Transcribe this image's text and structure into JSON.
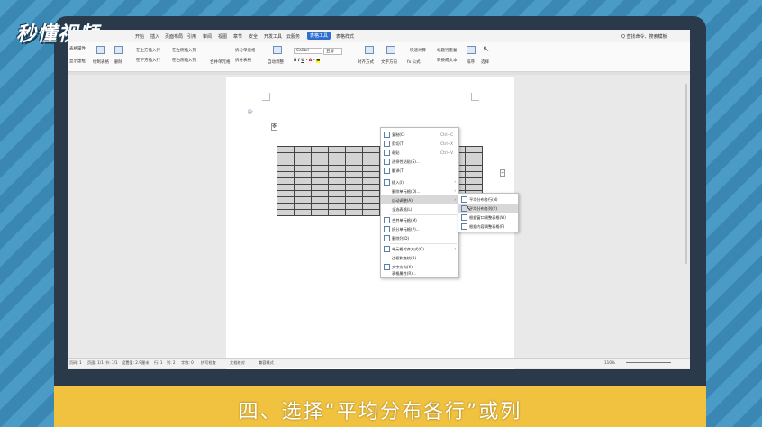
{
  "overlay": {
    "logo": "秒懂视频",
    "caption": "四、选择“平均分布各行”或列"
  },
  "menubar": {
    "items": [
      "开始",
      "插入",
      "页面布局",
      "引用",
      "审阅",
      "视图",
      "章节",
      "安全",
      "开发工具",
      "云服务",
      "表格工具",
      "表格样式"
    ],
    "active": "表格工具",
    "search": "Q 查找命令、搜索模板"
  },
  "ribbon": {
    "labels": [
      "表格属性",
      "显示虚框",
      "绘制表格",
      "删除",
      "在上方插入行",
      "在下方插入行",
      "在左侧插入列",
      "在右侧插入列",
      "合并单元格",
      "拆分单元格",
      "拆分表格",
      "自动调整",
      "Calibri",
      "五号",
      "对齐方式",
      "文字方向",
      "fx 公式",
      "快速计算",
      "标题行重复",
      "转换成文本",
      "排序",
      "选择"
    ]
  },
  "context_menu": {
    "items": [
      {
        "label": "复制(C)",
        "shortcut": "Ctrl+C"
      },
      {
        "label": "剪切(T)",
        "shortcut": "Ctrl+X"
      },
      {
        "label": "粘贴",
        "shortcut": "Ctrl+V"
      },
      {
        "label": "选择性粘贴(S)...",
        "shortcut": ""
      },
      {
        "label": "翻译(T)",
        "shortcut": ""
      },
      {
        "label": "插入(I)",
        "shortcut": ""
      },
      {
        "label": "删除单元格(D)...",
        "shortcut": ""
      },
      {
        "label": "自动调整(A)",
        "shortcut": ""
      },
      {
        "label": "全选表格(L)",
        "shortcut": ""
      },
      {
        "label": "合并单元格(M)",
        "shortcut": ""
      },
      {
        "label": "拆分单元格(P)...",
        "shortcut": ""
      },
      {
        "label": "删除列(D)",
        "shortcut": ""
      },
      {
        "label": "单元格对齐方式(G)",
        "shortcut": ""
      },
      {
        "label": "边框和底纹(B)...",
        "shortcut": ""
      },
      {
        "label": "文字方向(X)...",
        "shortcut": ""
      },
      {
        "label": "表格属性(R)...",
        "shortcut": ""
      }
    ]
  },
  "submenu": {
    "items": [
      "平均分布各行(N)",
      "平均分布各列(Y)",
      "根据窗口调整表格(W)",
      "根据内容调整表格(F)"
    ]
  },
  "statusbar": {
    "items": [
      "页码: 1",
      "页面: 1/1",
      "节: 1/1",
      "设置值: 2.9厘米",
      "行: 1",
      "列: 2",
      "字数: 0",
      "拼写检查",
      "文档校对",
      "兼容模式"
    ],
    "zoom": "110%"
  }
}
